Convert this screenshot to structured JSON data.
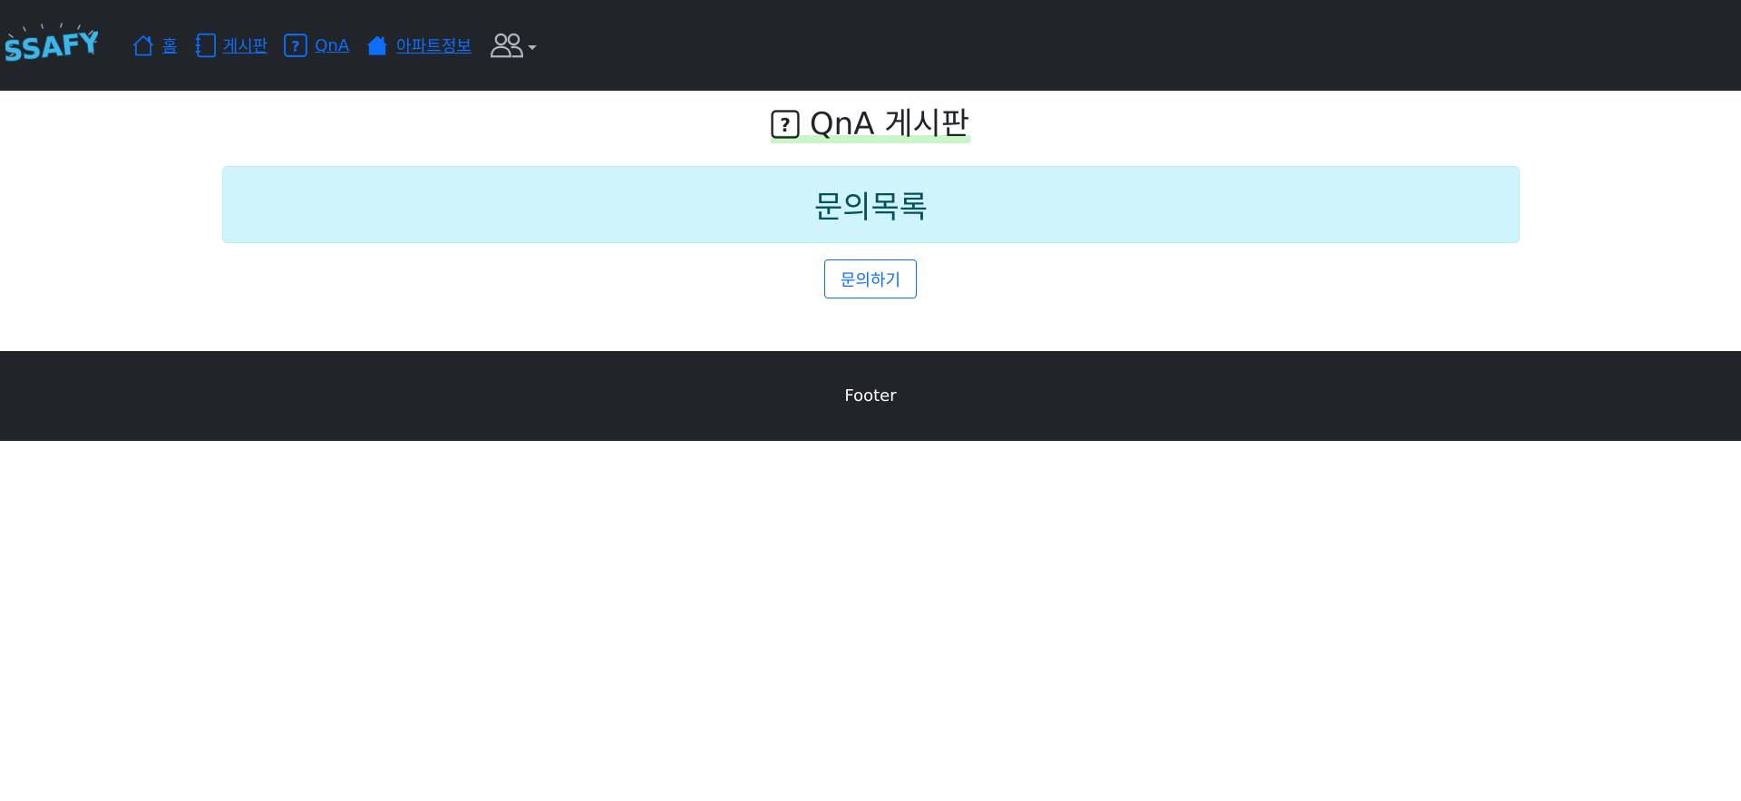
{
  "navbar": {
    "logo_text": "SSAFY",
    "links": [
      {
        "label": "홈",
        "icon": "house-icon"
      },
      {
        "label": "게시판",
        "icon": "journal-icon"
      },
      {
        "label": "QnA",
        "icon": "question-square-icon"
      },
      {
        "label": "아파트정보",
        "icon": "house-fill-icon"
      }
    ],
    "user_menu_icon": "people-icon",
    "link_color": "#0d6efd"
  },
  "main": {
    "title": "QnA 게시판",
    "title_icon": "question-square-icon",
    "list_heading": "문의목록",
    "ask_button": "문의하기"
  },
  "footer": {
    "text": "Footer"
  },
  "colors": {
    "navbar_bg": "#212529",
    "alert_bg": "#cff4fc",
    "title_highlight": "#c9f5c9"
  }
}
